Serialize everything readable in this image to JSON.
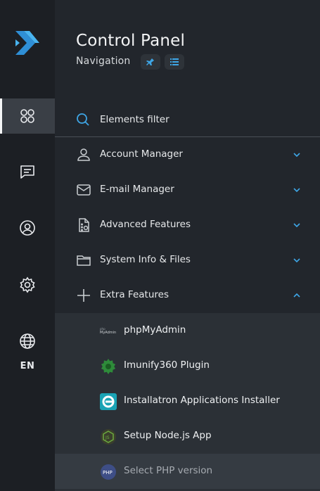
{
  "header": {
    "title": "Control Panel",
    "subtitle": "Navigation"
  },
  "rail": {
    "items": [
      {
        "name": "dashboard",
        "icon": "grid-icon",
        "active": true
      },
      {
        "name": "messages",
        "icon": "chat-icon",
        "active": false
      },
      {
        "name": "account",
        "icon": "user-circle-icon",
        "active": false
      },
      {
        "name": "settings",
        "icon": "gear-icon",
        "active": false
      },
      {
        "name": "language",
        "icon": "globe-icon",
        "active": false
      }
    ],
    "language_label": "EN"
  },
  "search": {
    "placeholder": "Elements filter"
  },
  "menu": [
    {
      "label": "Account Manager",
      "icon": "user-icon",
      "expanded": false
    },
    {
      "label": "E-mail Manager",
      "icon": "mail-icon",
      "expanded": false
    },
    {
      "label": "Advanced Features",
      "icon": "advanced-file-icon",
      "expanded": false
    },
    {
      "label": "System Info & Files",
      "icon": "folder-icon",
      "expanded": false
    },
    {
      "label": "Extra Features",
      "icon": "plus-icon",
      "expanded": true
    }
  ],
  "extra_features": [
    {
      "label": "phpMyAdmin",
      "icon": "phpmyadmin-icon"
    },
    {
      "label": "Imunify360 Plugin",
      "icon": "imunify-icon"
    },
    {
      "label": "Installatron Applications Installer",
      "icon": "installatron-icon"
    },
    {
      "label": "Setup Node.js App",
      "icon": "nodejs-icon"
    },
    {
      "label": "Select PHP version",
      "icon": "php-icon"
    }
  ],
  "colors": {
    "accent": "#3ea6e6",
    "rail_bg": "#1c1f24",
    "panel_bg": "#22262c",
    "submenu_bg": "#2b3036"
  }
}
